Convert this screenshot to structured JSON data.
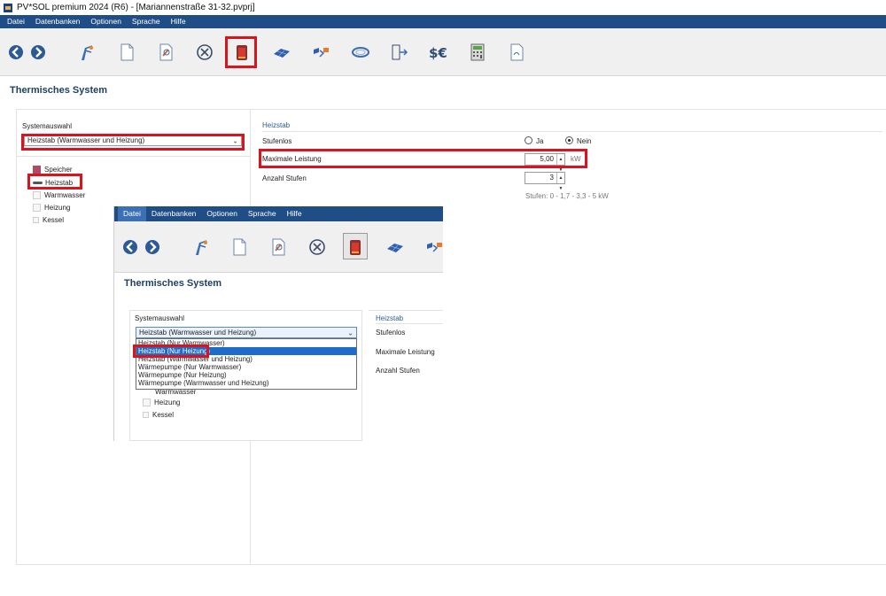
{
  "window": {
    "title": "PV*SOL premium 2024 (R6) - [Mariannenstraße 31-32.pvprj]"
  },
  "menu": [
    "Datei",
    "Datenbanken",
    "Optionen",
    "Sprache",
    "Hilfe"
  ],
  "toolbar_icons": [
    "back-icon",
    "forward-icon",
    "weather-station-icon",
    "document-icon",
    "edit-document-icon",
    "close-circle-icon",
    "heating-element-icon",
    "pv-module-icon",
    "cable-plan-icon",
    "ring-icon",
    "transfer-icon",
    "financial-analysis-icon",
    "calculator-icon",
    "report-icon"
  ],
  "page": {
    "title": "Thermisches System"
  },
  "left": {
    "system_label": "Systemauswahl",
    "system_value": "Heizstab (Warmwasser und Heizung)",
    "tree": [
      "Speicher",
      "Heizstab",
      "Warmwasser",
      "Heizung",
      "Kessel"
    ]
  },
  "right": {
    "section": "Heizstab",
    "stufenlos_label": "Stufenlos",
    "ja": "Ja",
    "nein": "Nein",
    "stufenlos_selected": "Nein",
    "max_label": "Maximale Leistung",
    "max_value": "5,00",
    "max_unit": "kW",
    "stufen_label": "Anzahl Stufen",
    "stufen_value": "3",
    "stufen_hint": "Stufen: 0 - 1,7 - 3,3 - 5 kW"
  },
  "inset": {
    "menu": [
      "Datei",
      "Datenbanken",
      "Optionen",
      "Sprache",
      "Hilfe"
    ],
    "page_title": "Thermisches System",
    "system_label": "Systemauswahl",
    "system_value": "Heizstab (Warmwasser und Heizung)",
    "options": [
      "Heizstab (Nur Warmwasser)",
      "Heizstab (Nur Heizung)",
      "Heizstab (Warmwasser und Heizung)",
      "Wärmepumpe (Nur Warmwasser)",
      "Wärmepumpe (Nur Heizung)",
      "Wärmepumpe (Warmwasser und Heizung)"
    ],
    "selected_option": "Heizstab (Nur Heizung)",
    "tree_partial": "Warmwasser",
    "tree": [
      "Heizung",
      "Kessel"
    ],
    "section": "Heizstab",
    "stufenlos_label": "Stufenlos",
    "max_label": "Maximale Leistung",
    "stufen_label": "Anzahl Stufen"
  },
  "colors": {
    "menubar": "#1f4e86",
    "highlight": "#d9141e",
    "selection": "#1f6bc8",
    "title": "#1f3f66"
  }
}
